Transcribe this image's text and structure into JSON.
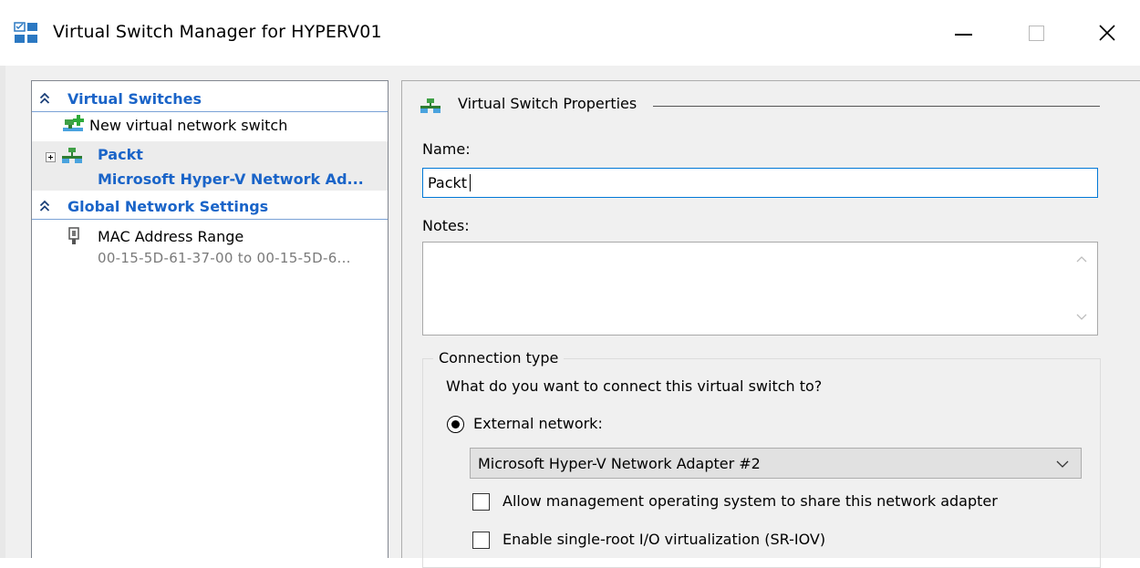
{
  "window": {
    "title": "Virtual Switch Manager for HYPERV01"
  },
  "tree": {
    "virtual_switches_header": "Virtual Switches",
    "new_switch_label": "New virtual network switch",
    "switch_name": "Packt",
    "switch_adapter": "Microsoft Hyper-V Network Ad...",
    "global_settings_header": "Global Network Settings",
    "mac_label": "MAC Address Range",
    "mac_value": "00-15-5D-61-37-00 to 00-15-5D-6..."
  },
  "props": {
    "section_title": "Virtual Switch Properties",
    "name_label": "Name:",
    "name_value": "Packt",
    "notes_label": "Notes:",
    "notes_value": "",
    "connection_type_legend": "Connection type",
    "connection_question": "What do you want to connect this virtual switch to?",
    "external_label": "External network:",
    "adapter_selected": "Microsoft Hyper-V Network Adapter #2",
    "allow_mgmt_label": "Allow management operating system to share this network adapter",
    "sriov_label": "Enable single-root I/O virtualization (SR-IOV)"
  },
  "colors": {
    "accent_blue": "#1a64c8",
    "focus_border": "#0078d7",
    "dialog_bg": "#f0f0f0"
  },
  "icons": {
    "app": "virtual-switch-manager-icon",
    "switch": "network-switch-icon",
    "new_switch": "network-switch-add-icon",
    "mac": "network-plug-icon"
  }
}
